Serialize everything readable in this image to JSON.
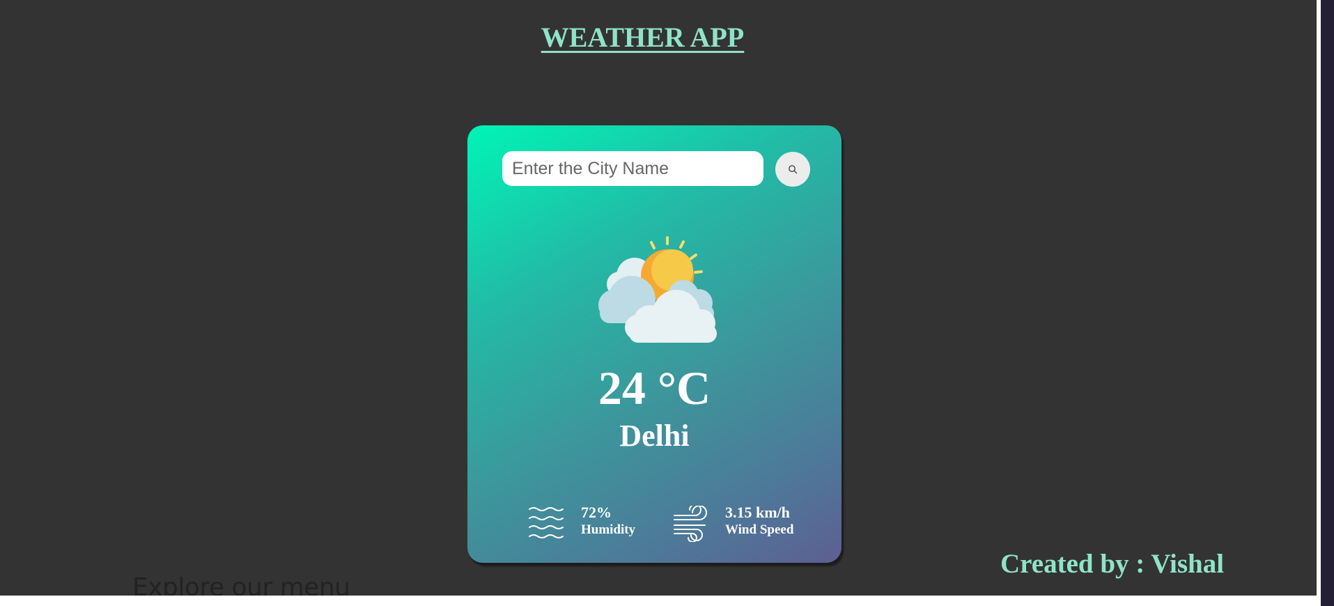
{
  "page": {
    "title": "WEATHER APP",
    "credit": "Created by : Vishal",
    "below_fold_heading": "Explore our menu"
  },
  "search": {
    "placeholder": "Enter the City Name",
    "value": "",
    "button_icon": "search-icon"
  },
  "weather": {
    "icon": "partly-cloudy-sun-icon",
    "temperature": "24 °C",
    "city": "Delhi",
    "humidity": {
      "value": "72%",
      "label": "Humidity",
      "icon": "humidity-waves-icon"
    },
    "wind": {
      "value": "3.15 km/h",
      "label": "Wind Speed",
      "icon": "wind-icon"
    }
  },
  "colors": {
    "page_background": "#333333",
    "title_accent": "#8fe3c8",
    "card_gradient_start": "#00f5b6",
    "card_gradient_end": "#5d5f92",
    "text_on_card": "#ffffff"
  }
}
